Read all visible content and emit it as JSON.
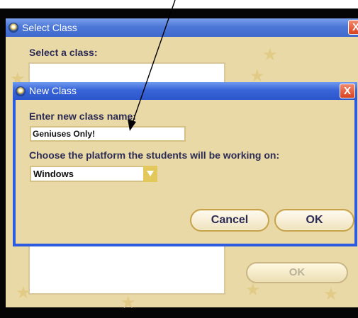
{
  "select_class_window": {
    "title": "Select Class",
    "close_label": "X",
    "prompt_label": "Select a class:",
    "ok_label": "OK"
  },
  "new_class_dialog": {
    "title": "New Class",
    "close_label": "X",
    "name_label": "Enter new class name:",
    "name_value": "Geniuses Only!",
    "platform_label": "Choose the platform the students will be working on:",
    "platform_value": "Windows",
    "cancel_label": "Cancel",
    "ok_label": "OK"
  },
  "icons": [
    "window-app-icon",
    "close-icon",
    "dropdown-arrow-icon",
    "star-decoration-icon",
    "pointer-arrow-icon"
  ],
  "colors": {
    "title_bar": "#3f69cc",
    "window_body": "#e9d9a6",
    "close_button": "#d8431f",
    "label_text": "#2b2b55",
    "dropdown_arrow": "#e3c95c",
    "frame": "#050505"
  }
}
